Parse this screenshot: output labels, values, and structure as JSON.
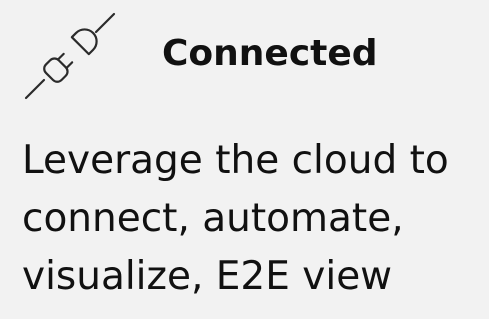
{
  "card": {
    "icon": "plug-icon",
    "title": "Connected",
    "description_lines": [
      "Leverage the cloud to",
      "connect, automate,",
      "visualize, E2E view"
    ]
  },
  "colors": {
    "background": "#f2f2f2",
    "text": "#111111"
  }
}
